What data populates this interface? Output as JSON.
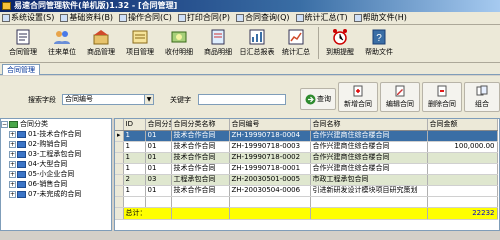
{
  "window": {
    "title": "易速合同管理软件(单机版)1.32 - [合同管理]"
  },
  "menu": [
    {
      "label": "系统设置(S)",
      "icon": "settings-icon"
    },
    {
      "label": "基础资料(B)",
      "icon": "database-icon"
    },
    {
      "label": "操作合同(C)",
      "icon": "contract-icon"
    },
    {
      "label": "打印合同(P)",
      "icon": "printer-icon"
    },
    {
      "label": "合同查询(Q)",
      "icon": "query-icon"
    },
    {
      "label": "统计汇总(T)",
      "icon": "stats-icon"
    },
    {
      "label": "帮助文件(H)",
      "icon": "help-icon"
    }
  ],
  "toolbar": [
    {
      "label": "合同管理",
      "icon": "contract-manage-icon"
    },
    {
      "label": "往来单位",
      "icon": "partner-icon"
    },
    {
      "label": "商品管理",
      "icon": "goods-icon"
    },
    {
      "label": "项目管理",
      "icon": "project-icon"
    },
    {
      "label": "收付明细",
      "icon": "payment-icon"
    },
    {
      "label": "商品明细",
      "icon": "goods-detail-icon"
    },
    {
      "label": "日汇总报表",
      "icon": "daily-report-icon"
    },
    {
      "label": "统计汇总",
      "icon": "statistics-icon"
    },
    {
      "label": "到期提醒",
      "icon": "alarm-clock-icon"
    },
    {
      "label": "帮助文件",
      "icon": "help-book-icon"
    }
  ],
  "tab": {
    "label": "合同管理"
  },
  "search": {
    "field_label": "搜索字段",
    "field_value": "合同编号",
    "keyword_label": "关键字",
    "keyword_value": "",
    "query_button": "查询",
    "new_button": "新增合同",
    "edit_button": "编辑合同",
    "delete_button": "删除合同",
    "more_button": "组合"
  },
  "tree": {
    "root": "合同分类",
    "items": [
      "01-技术合作合同",
      "02-购销合同",
      "03-工程承包合同",
      "04-大型合同",
      "05-小企业合同",
      "06-销售合同",
      "07-未完成的合同"
    ]
  },
  "grid": {
    "columns": [
      "ID",
      "合同分类",
      "合同分类名称",
      "合同编号",
      "合同名称",
      "合同金额"
    ],
    "rows": [
      {
        "id": "1",
        "cat": "01",
        "cat_name": "技术合作合同",
        "no": "ZH-19990718-0004",
        "name": "合作兴建商住综合楼合同",
        "amount": "",
        "state": "sel"
      },
      {
        "id": "1",
        "cat": "01",
        "cat_name": "技术合作合同",
        "no": "ZH-19990718-0003",
        "name": "合作兴建商住综合楼合同",
        "amount": "100,000.00",
        "state": "white"
      },
      {
        "id": "1",
        "cat": "01",
        "cat_name": "技术合作合同",
        "no": "ZH-19990718-0002",
        "name": "合作兴建商住综合楼合同",
        "amount": "",
        "state": "alt"
      },
      {
        "id": "1",
        "cat": "01",
        "cat_name": "技术合作合同",
        "no": "ZH-19990718-0001",
        "name": "合作兴建商住综合楼合同",
        "amount": "",
        "state": "white"
      },
      {
        "id": "2",
        "cat": "03",
        "cat_name": "工程承包合同",
        "no": "ZH-20030501-0005",
        "name": "市政工程承包合同",
        "amount": "",
        "state": "alt"
      },
      {
        "id": "1",
        "cat": "01",
        "cat_name": "技术合作合同",
        "no": "ZH-20030504-0006",
        "name": "引进新研发设计模块项目研究策划",
        "amount": "",
        "state": "white"
      }
    ],
    "total_label": "总计：",
    "total_amount": "22232"
  }
}
